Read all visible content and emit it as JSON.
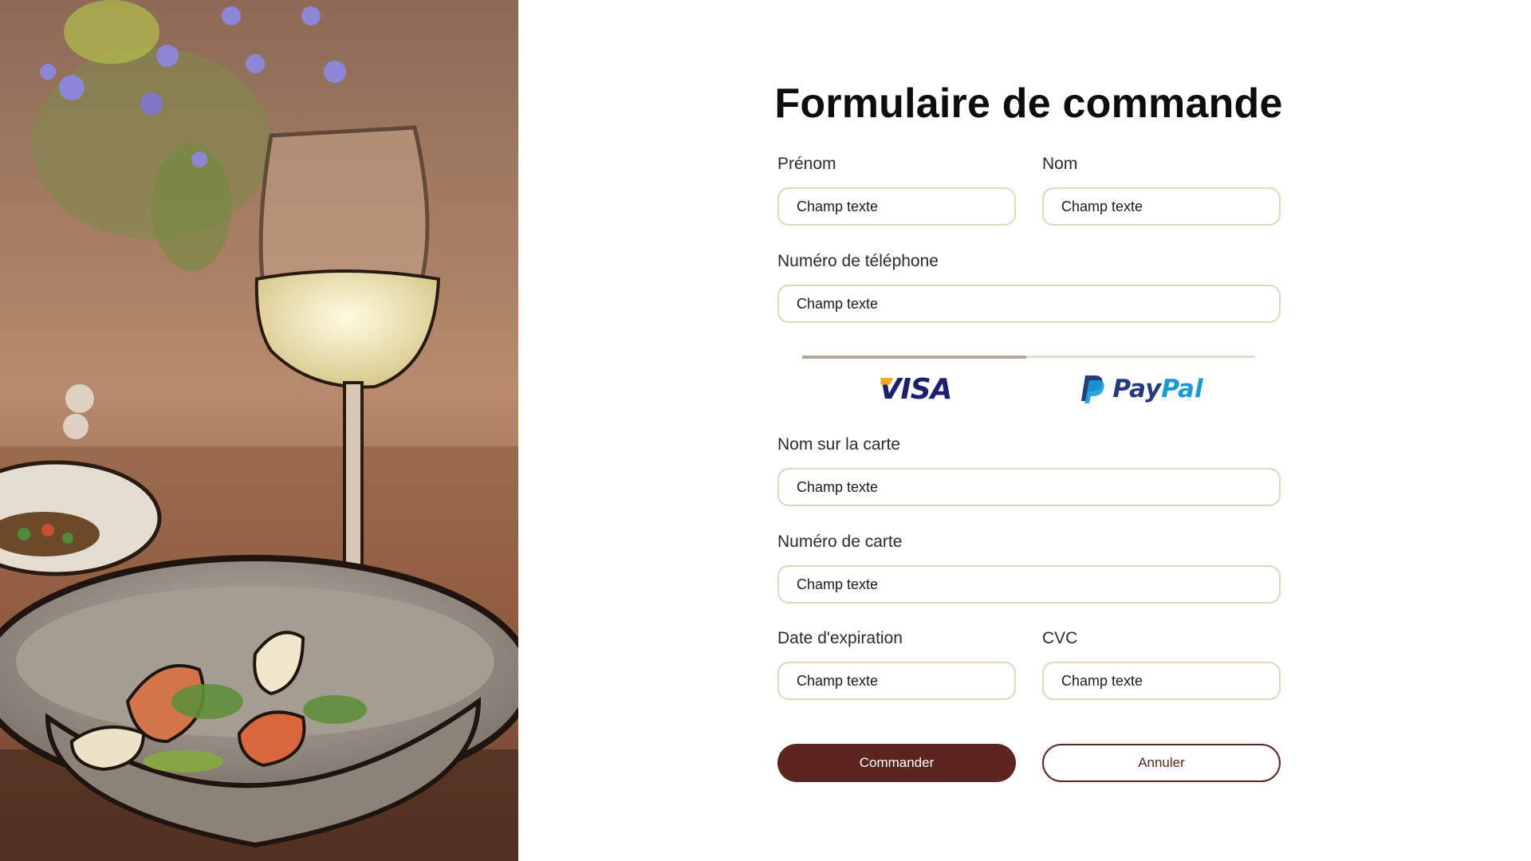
{
  "form": {
    "title": "Formulaire de commande",
    "fields": {
      "first_name": {
        "label": "Prénom",
        "placeholder": "Champ texte"
      },
      "last_name": {
        "label": "Nom",
        "placeholder": "Champ texte"
      },
      "phone": {
        "label": "Numéro de téléphone",
        "placeholder": "Champ texte"
      },
      "card_name": {
        "label": "Nom sur la carte",
        "placeholder": "Champ texte"
      },
      "card_number": {
        "label": "Numéro de carte",
        "placeholder": "Champ texte"
      },
      "expiry": {
        "label": "Date d'expiration",
        "placeholder": "Champ texte"
      },
      "cvc": {
        "label": "CVC",
        "placeholder": "Champ texte"
      }
    },
    "payment": {
      "options": [
        "VISA",
        "PayPal"
      ],
      "selected": "VISA",
      "visa_label": "VISA",
      "paypal_label_1": "Pay",
      "paypal_label_2": "Pal"
    },
    "buttons": {
      "submit": "Commander",
      "cancel": "Annuler"
    }
  },
  "icons": {
    "photo": "restaurant-table-photo",
    "visa": "visa-logo-icon",
    "paypal": "paypal-logo-icon"
  },
  "colors": {
    "primary": "#5c2520",
    "field_border": "#e3d6bd",
    "visa_blue": "#1a1f71",
    "visa_gold": "#f7a823",
    "paypal_dark": "#253b80",
    "paypal_light": "#179bd7"
  }
}
